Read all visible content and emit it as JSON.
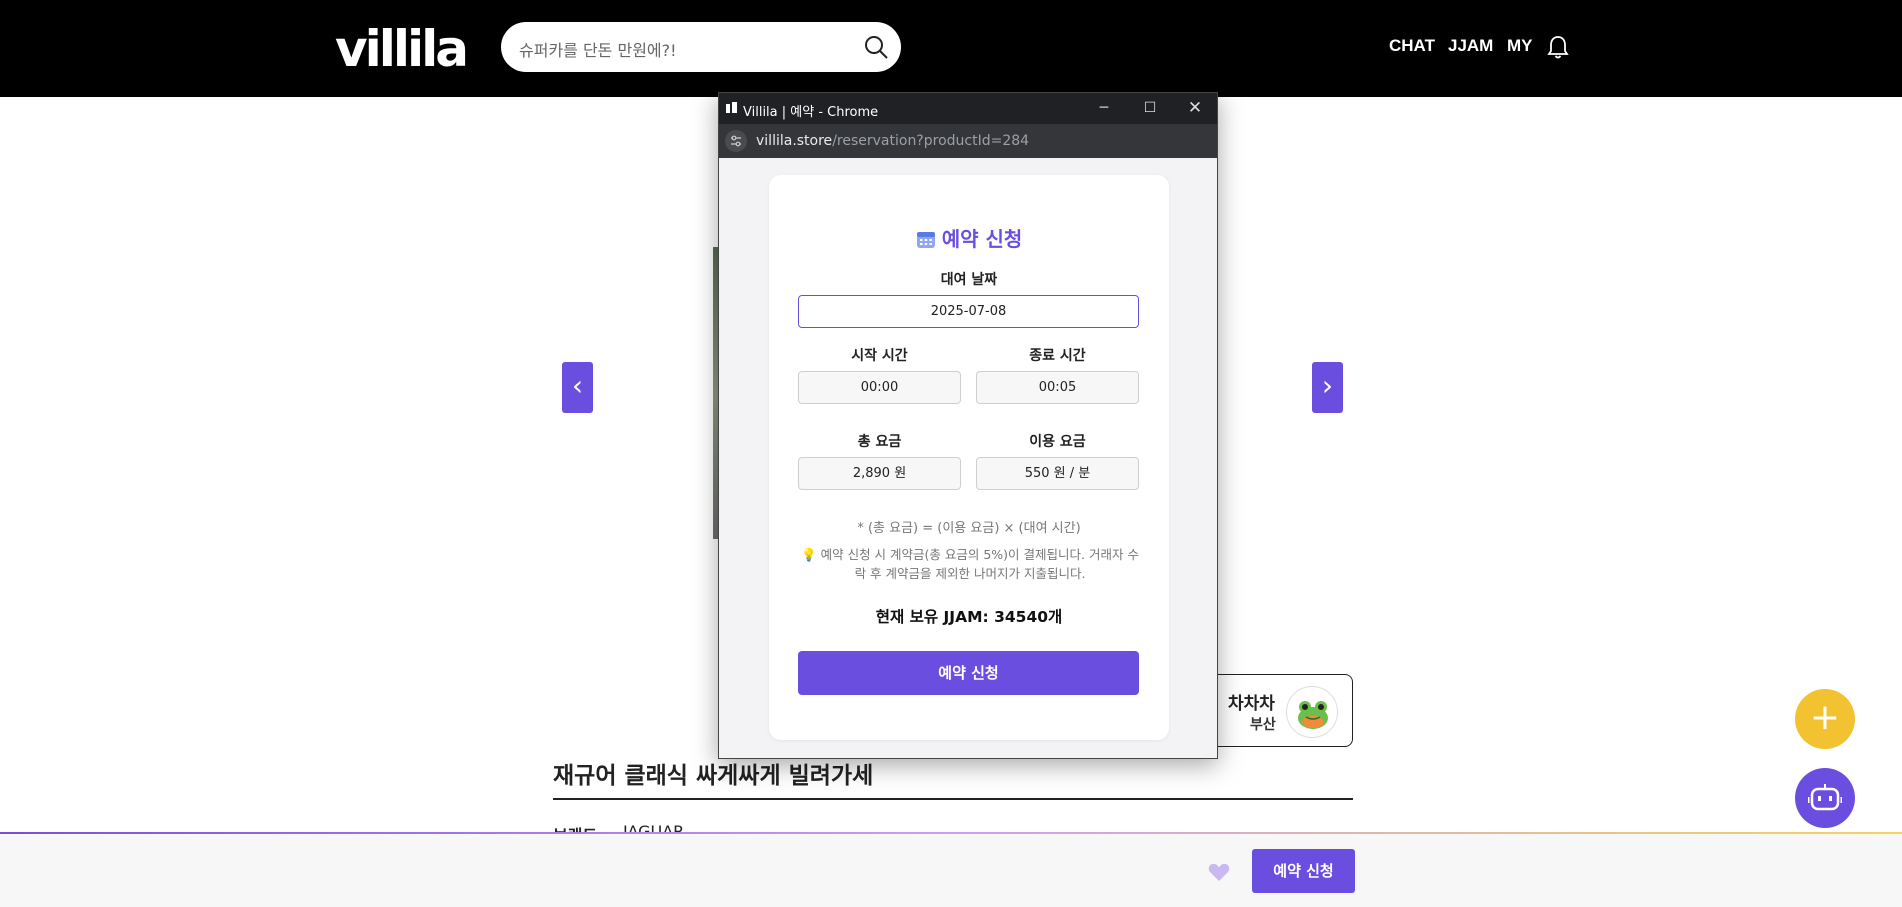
{
  "header": {
    "logo": "villila",
    "search_placeholder": "슈퍼카를 단돈 만원에?!",
    "nav": {
      "chat": "CHAT",
      "jjam": "JJAM",
      "my": "MY"
    }
  },
  "page": {
    "carousel_prev": "‹",
    "carousel_next": "›",
    "owner": {
      "name": "차차차",
      "location": "부산"
    },
    "product_title": "재규어 클래식 싸게싸게 빌려가세",
    "brand_label": "브랜드:",
    "brand_value": "JAGUAR"
  },
  "bottombar": {
    "reserve_label": "예약 신청"
  },
  "fab": {
    "add": "+"
  },
  "popup": {
    "window_title": "Villila | 예약 - Chrome",
    "url_host": "villila.store",
    "url_path": "/reservation?productId=284",
    "heading": "예약 신청",
    "date_label": "대여 날짜",
    "date_value": "2025-07-08",
    "start_label": "시작 시간",
    "start_value": "00:00",
    "end_label": "종료 시간",
    "end_value": "00:05",
    "total_label": "총 요금",
    "total_value": "2,890 원",
    "rate_label": "이용 요금",
    "rate_value": "550 원 / 분",
    "formula": "* (총 요금) = (이용 요금) × (대여 시간)",
    "notice": "예약 신청 시 계약금(총 요금의 5%)이 결제됩니다. 거래자 수락 후 계약금을 제외한 나머지가 지출됩니다.",
    "jjam_balance": "현재 보유 JJAM: 34540개",
    "submit_label": "예약 신청"
  },
  "colors": {
    "accent": "#6a4ee0",
    "fab_yellow": "#f2c230",
    "header_bg": "#000000"
  }
}
